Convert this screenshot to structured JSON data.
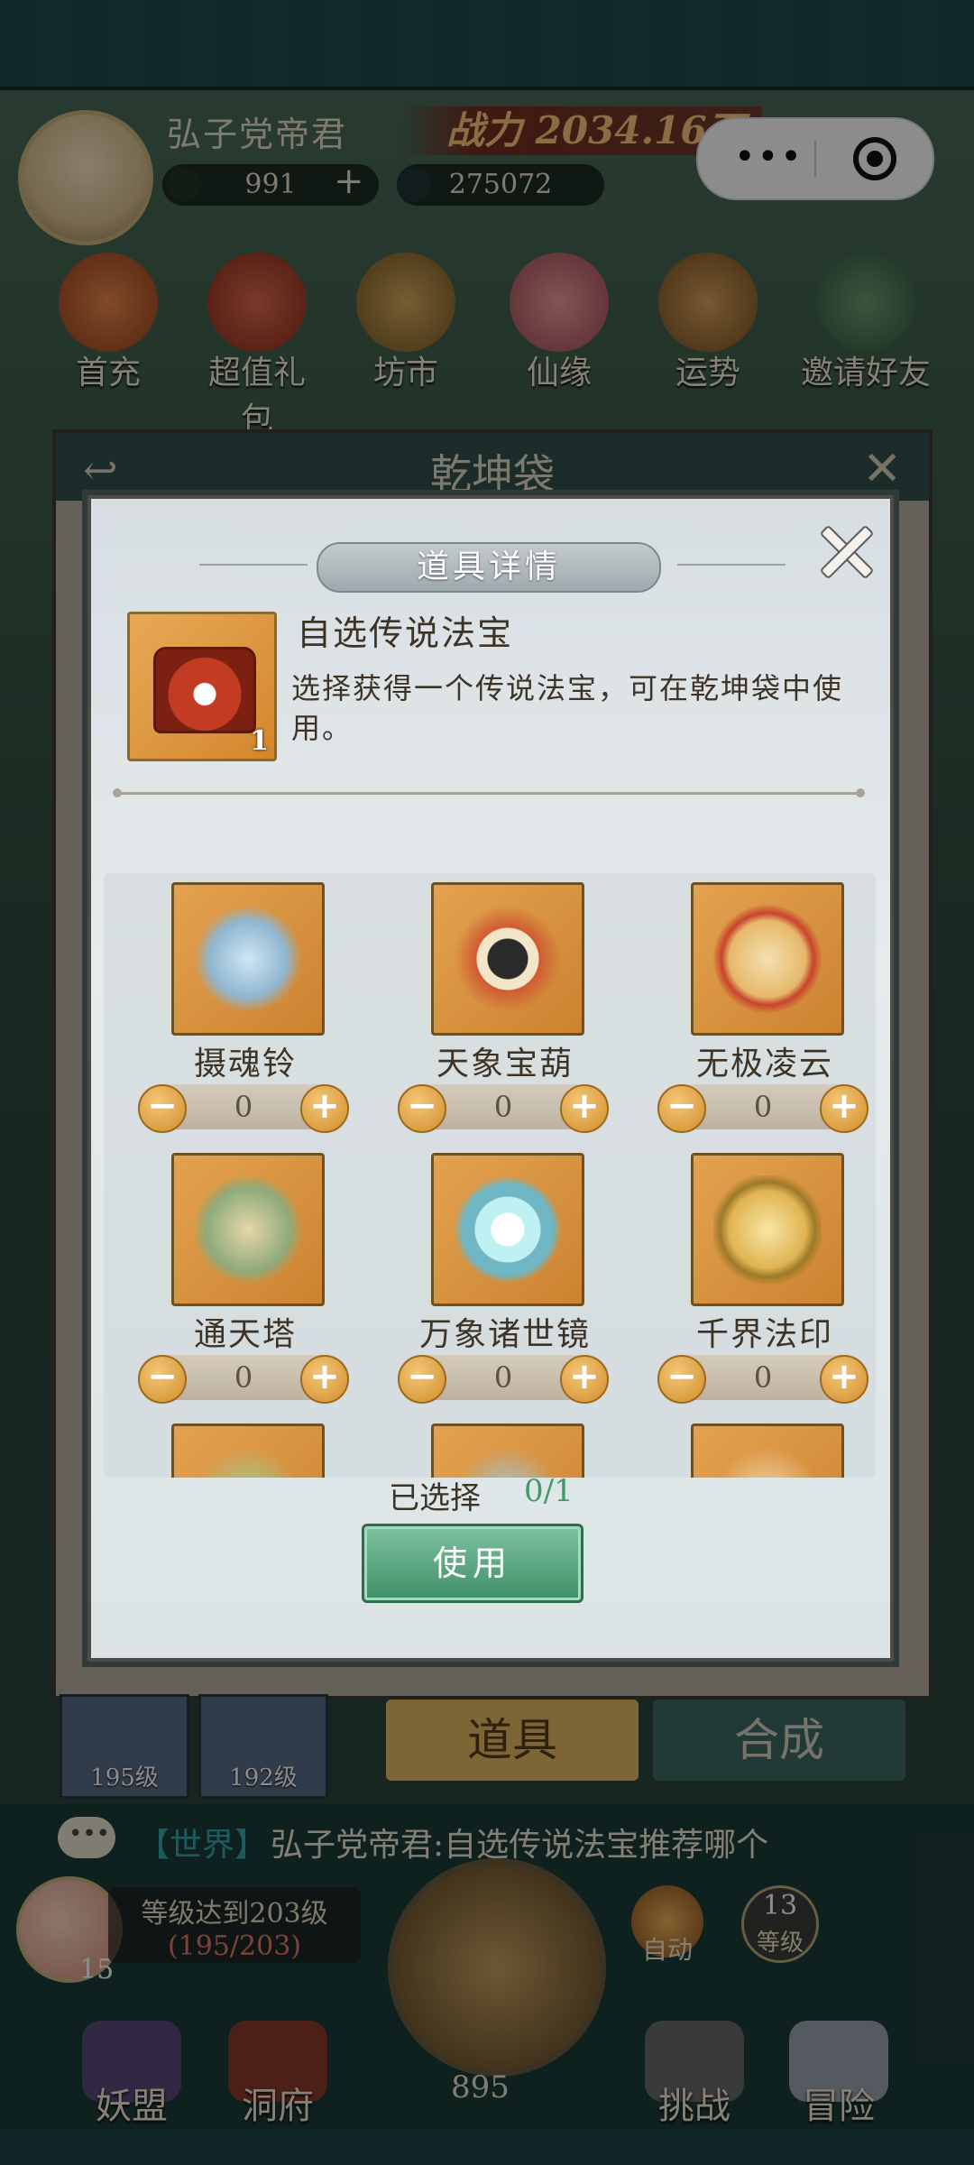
{
  "player": {
    "name": "弘子党帝君",
    "power": "战力 2034.16万",
    "currency1": "991",
    "currency2": "275072",
    "add_symbol": "+"
  },
  "top_menu": [
    {
      "label": "首充"
    },
    {
      "label": "超值礼包"
    },
    {
      "label": "坊市"
    },
    {
      "label": "仙缘"
    },
    {
      "label": "运势"
    },
    {
      "label": "邀请好友"
    }
  ],
  "bag": {
    "title": "乾坤袋",
    "tabs": {
      "items": "道具",
      "compose": "合成"
    },
    "thumbs": [
      {
        "level": "195级"
      },
      {
        "level": "192级"
      }
    ]
  },
  "modal": {
    "title": "道具详情",
    "item": {
      "name": "自选传说法宝",
      "count": "1",
      "description": "选择获得一个传说法宝，可在乾坤袋中使用。"
    },
    "options": [
      {
        "name": "摄魂铃",
        "qty": "0"
      },
      {
        "name": "天象宝葫",
        "qty": "0"
      },
      {
        "name": "无极凌云",
        "qty": "0"
      },
      {
        "name": "通天塔",
        "qty": "0"
      },
      {
        "name": "万象诸世镜",
        "qty": "0"
      },
      {
        "name": "千界法印",
        "qty": "0"
      }
    ],
    "stepper": {
      "minus": "−",
      "plus": "+"
    },
    "selected_label": "已选择",
    "selected_value": "0/1",
    "use_button": "使用"
  },
  "chat": {
    "channel": "【世界】",
    "message": "弘子党帝君:自选传说法宝推荐哪个"
  },
  "bottom": {
    "level_goal": "等级达到203级",
    "level_progress": "(195/203)",
    "peach_count": "15",
    "axe_count": "895",
    "auto_label": "自动",
    "level_number": "13",
    "level_label": "等级",
    "nav": [
      {
        "label": "妖盟"
      },
      {
        "label": "洞府"
      },
      {
        "label": "挑战"
      },
      {
        "label": "冒险"
      }
    ]
  },
  "colors": {
    "accent_green": "#3f9a68",
    "gold": "#d28d2a",
    "modal_bg": "#e6ebec"
  }
}
